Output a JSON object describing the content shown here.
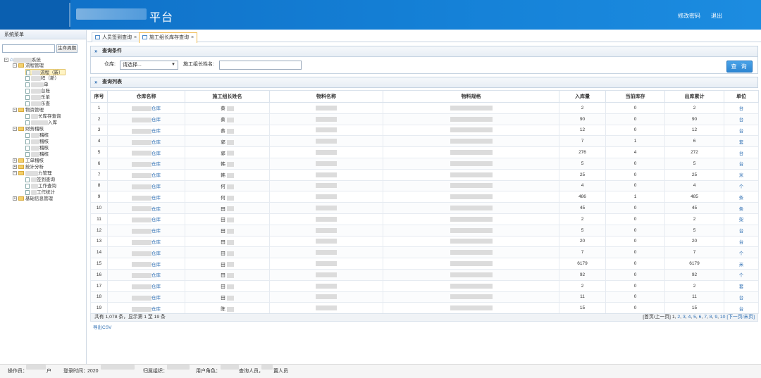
{
  "header": {
    "title": "平台",
    "links": [
      "修改密码",
      "退出"
    ]
  },
  "sidebar": {
    "title": "系统菜单",
    "search_button": "生命周期",
    "items": [
      {
        "label": "系统"
      },
      {
        "label": "流程管理"
      },
      {
        "label": "流程（新）"
      },
      {
        "label": "程（新）"
      },
      {
        "label": "单"
      },
      {
        "label": "台账"
      },
      {
        "label": "乐单"
      },
      {
        "label": "乐查"
      },
      {
        "label": "物资管理"
      },
      {
        "label": "长库存查询"
      },
      {
        "label": "入库"
      },
      {
        "label": "财务稽核"
      },
      {
        "label": "稽核"
      },
      {
        "label": "稽核"
      },
      {
        "label": "稽核"
      },
      {
        "label": "稽核"
      },
      {
        "label": "工单稽核"
      },
      {
        "label": "统计分析"
      },
      {
        "label": "力管理"
      },
      {
        "label": "签到查询"
      },
      {
        "label": "工作查询"
      },
      {
        "label": "工作统计"
      },
      {
        "label": "基础信息管理"
      }
    ]
  },
  "tabs": [
    {
      "label": "人员签到查询",
      "close": "×"
    },
    {
      "label": "施工组长库存查询",
      "close": "×"
    }
  ],
  "query": {
    "section_title": "查询条件",
    "warehouse_label": "仓库:",
    "warehouse_value": "请选择...",
    "leader_label": "施工组长姓名:",
    "leader_value": "",
    "button": "查 询"
  },
  "list": {
    "section_title": "查询列表",
    "columns": [
      "序号",
      "仓库名称",
      "施工组长姓名",
      "物料名称",
      "物料规格",
      "入库量",
      "当前库存",
      "出库累计",
      "单位"
    ],
    "rows": [
      {
        "no": "1",
        "warehouse": "仓库",
        "leader": "蔡",
        "in": "2",
        "stock": "0",
        "out": "2",
        "unit": "台"
      },
      {
        "no": "2",
        "warehouse": "仓库",
        "leader": "蔡",
        "in": "90",
        "stock": "0",
        "out": "90",
        "unit": "台"
      },
      {
        "no": "3",
        "warehouse": "仓库",
        "leader": "蔡",
        "in": "12",
        "stock": "0",
        "out": "12",
        "unit": "台"
      },
      {
        "no": "4",
        "warehouse": "仓库",
        "leader": "郭",
        "in": "7",
        "stock": "1",
        "out": "6",
        "unit": "套"
      },
      {
        "no": "5",
        "warehouse": "仓库",
        "leader": "郭",
        "in": "276",
        "stock": "4",
        "out": "272",
        "unit": "台"
      },
      {
        "no": "6",
        "warehouse": "仓库",
        "leader": "韩",
        "in": "5",
        "stock": "0",
        "out": "5",
        "unit": "台"
      },
      {
        "no": "7",
        "warehouse": "仓库",
        "leader": "韩",
        "in": "25",
        "stock": "0",
        "out": "25",
        "unit": "米"
      },
      {
        "no": "8",
        "warehouse": "仓库",
        "leader": "何",
        "in": "4",
        "stock": "0",
        "out": "4",
        "unit": "个"
      },
      {
        "no": "9",
        "warehouse": "仓库",
        "leader": "何",
        "in": "486",
        "stock": "1",
        "out": "485",
        "unit": "条"
      },
      {
        "no": "10",
        "warehouse": "仓库",
        "leader": "田",
        "in": "45",
        "stock": "0",
        "out": "45",
        "unit": "条"
      },
      {
        "no": "11",
        "warehouse": "仓库",
        "leader": "田",
        "in": "2",
        "stock": "0",
        "out": "2",
        "unit": "架"
      },
      {
        "no": "12",
        "warehouse": "仓库",
        "leader": "田",
        "in": "5",
        "stock": "0",
        "out": "5",
        "unit": "台"
      },
      {
        "no": "13",
        "warehouse": "仓库",
        "leader": "田",
        "in": "20",
        "stock": "0",
        "out": "20",
        "unit": "台"
      },
      {
        "no": "14",
        "warehouse": "仓库",
        "leader": "田",
        "in": "7",
        "stock": "0",
        "out": "7",
        "unit": "个"
      },
      {
        "no": "15",
        "warehouse": "仓库",
        "leader": "田",
        "in": "6179",
        "stock": "0",
        "out": "6179",
        "unit": "米"
      },
      {
        "no": "16",
        "warehouse": "仓库",
        "leader": "田",
        "in": "92",
        "stock": "0",
        "out": "92",
        "unit": "个"
      },
      {
        "no": "17",
        "warehouse": "仓库",
        "leader": "田",
        "in": "2",
        "stock": "0",
        "out": "2",
        "unit": "套"
      },
      {
        "no": "18",
        "warehouse": "仓库",
        "leader": "田",
        "in": "11",
        "stock": "0",
        "out": "11",
        "unit": "台"
      },
      {
        "no": "19",
        "warehouse": "仓库",
        "leader": "陈",
        "in": "15",
        "stock": "0",
        "out": "15",
        "unit": "台"
      }
    ],
    "summary": "共有 1,078 条，显示第 1 至 19 条",
    "pager_prefix": "[首页/上一页]",
    "pages": [
      "1",
      "2",
      "3",
      "4",
      "5",
      "6",
      "7",
      "8",
      "9",
      "10"
    ],
    "pager_suffix": "[下一页/末页]",
    "export": "导出CSV"
  },
  "footer": {
    "operator_label": "操作员：",
    "operator_suffix": "户",
    "login_label": "登录时间：",
    "login_value": "2020",
    "org_label": "归属组织：",
    "role_label": "用户角色：",
    "role_value_1": "查询人员，",
    "role_value_2": "置人员"
  },
  "colors": {
    "header_blue": "#1581d7",
    "link_blue": "#2f6fb3",
    "button_blue": "#2d86d3"
  }
}
